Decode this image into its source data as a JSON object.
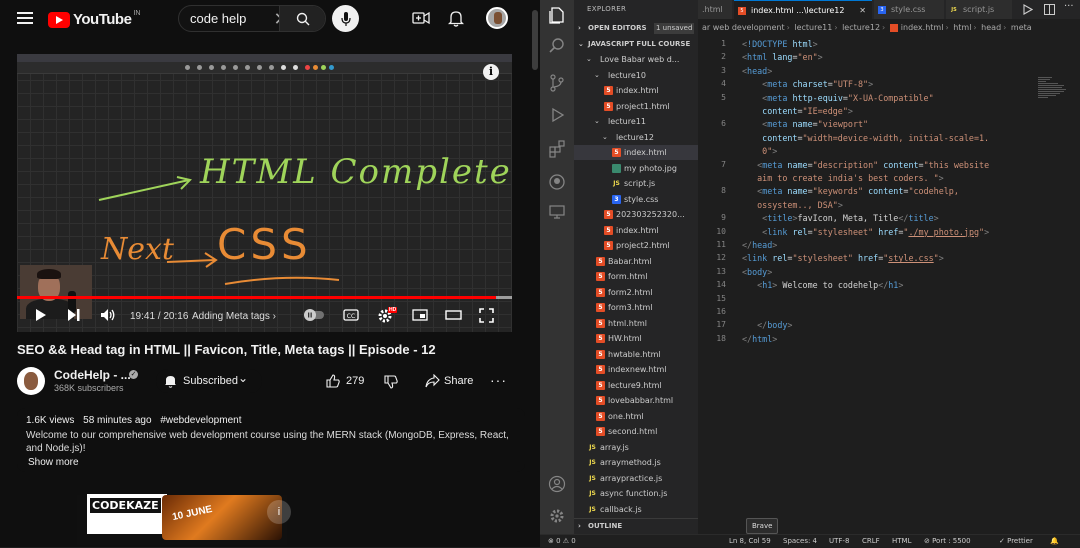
{
  "youtube": {
    "logo_text": "YouTube",
    "logo_region": "IN",
    "search_value": "code help",
    "video": {
      "handwriting_line1": "HTML Complete",
      "handwriting_next": "Next",
      "handwriting_css": "CSS",
      "time": "19:41 / 20:16",
      "chapter": "Adding Meta tags",
      "chapter_arrow": "›",
      "hd_badge": "HD",
      "progress_pct": 96.8,
      "loaded_pct": 100
    },
    "title": "SEO && Head tag in HTML || Favicon, Title, Meta tags || Episode - 12",
    "channel_name": "CodeHelp - ...",
    "verified_mark": "✓",
    "subscribers": "368K subscribers",
    "subscribed_label": "Subscribed",
    "subscribed_chevron": "⌄",
    "likes": "279",
    "share_label": "Share",
    "more_label": "···",
    "description": {
      "views": "1.6K views",
      "time_ago": "58 minutes ago",
      "hashtag": "#webdevelopment",
      "text": "Welcome to our comprehensive web development course using the MERN stack (MongoDB, Express, React, and Node.js)!",
      "show_more": "Show more"
    },
    "ad": {
      "brand": "CODEKAZE",
      "date": "10 JUNE",
      "info_glyph": "i"
    },
    "info_glyph": "i",
    "clear_glyph": "✕"
  },
  "vscode": {
    "explorer_title": "EXPLORER",
    "open_editors": "OPEN EDITORS",
    "unsaved": "1 unsaved",
    "workspace": "JAVASCRIPT FULL COURSE",
    "outline": "OUTLINE",
    "tree": [
      {
        "label": "Love Babar web d...",
        "kind": "folder",
        "indent": 1,
        "open": true
      },
      {
        "label": "lecture10",
        "kind": "folder",
        "indent": 2,
        "open": true
      },
      {
        "label": "index.html",
        "kind": "html",
        "indent": 3
      },
      {
        "label": "project1.html",
        "kind": "html",
        "indent": 3
      },
      {
        "label": "lecture11",
        "kind": "folder",
        "indent": 2,
        "open": true
      },
      {
        "label": "lecture12",
        "kind": "folder",
        "indent": 3,
        "open": true
      },
      {
        "label": "index.html",
        "kind": "html",
        "indent": 4,
        "selected": true
      },
      {
        "label": "my photo.jpg",
        "kind": "img",
        "indent": 4
      },
      {
        "label": "script.js",
        "kind": "js",
        "indent": 4
      },
      {
        "label": "style.css",
        "kind": "css",
        "indent": 4
      },
      {
        "label": "202303252320...",
        "kind": "html",
        "indent": 3
      },
      {
        "label": "index.html",
        "kind": "html",
        "indent": 3
      },
      {
        "label": "project2.html",
        "kind": "html",
        "indent": 3
      },
      {
        "label": "Babar.html",
        "kind": "html",
        "indent": 2
      },
      {
        "label": "form.html",
        "kind": "html",
        "indent": 2
      },
      {
        "label": "form2.html",
        "kind": "html",
        "indent": 2
      },
      {
        "label": "form3.html",
        "kind": "html",
        "indent": 2
      },
      {
        "label": "html.html",
        "kind": "html",
        "indent": 2
      },
      {
        "label": "HW.html",
        "kind": "html",
        "indent": 2
      },
      {
        "label": "hwtable.html",
        "kind": "html",
        "indent": 2
      },
      {
        "label": "indexnew.html",
        "kind": "html",
        "indent": 2
      },
      {
        "label": "lecture9.html",
        "kind": "html",
        "indent": 2
      },
      {
        "label": "lovebabbar.html",
        "kind": "html",
        "indent": 2
      },
      {
        "label": "one.html",
        "kind": "html",
        "indent": 2
      },
      {
        "label": "second.html",
        "kind": "html",
        "indent": 2
      },
      {
        "label": "array.js",
        "kind": "js",
        "indent": 1
      },
      {
        "label": "arraymethod.js",
        "kind": "js",
        "indent": 1
      },
      {
        "label": "arraypractice.js",
        "kind": "js",
        "indent": 1
      },
      {
        "label": "async function.js",
        "kind": "js",
        "indent": 1
      },
      {
        "label": "callback.js",
        "kind": "js",
        "indent": 1
      }
    ],
    "tabs": [
      {
        "label": ".html",
        "icon": ""
      },
      {
        "label": "index.html ...\\lecture12",
        "icon": "5",
        "active": true
      },
      {
        "label": "style.css",
        "icon": "3"
      },
      {
        "label": "script.js",
        "icon": "JS"
      }
    ],
    "breadcrumbs": [
      "ar web development",
      "lecture11",
      "lecture12",
      "index.html",
      "html",
      "head",
      "meta"
    ],
    "code_lines": [
      {
        "n": "1",
        "h": "<span class='p'>&lt;</span><span class='t'>!DOCTYPE</span> <span class='a'>html</span><span class='p'>&gt;</span>"
      },
      {
        "n": "2",
        "h": "<span class='p'>&lt;</span><span class='t'>html</span> <span class='a'>lang</span>=<span class='s'>\"en\"</span><span class='p'>&gt;</span>"
      },
      {
        "n": "3",
        "h": "<span class='p'>&lt;</span><span class='t'>head</span><span class='p'>&gt;</span>"
      },
      {
        "n": "4",
        "h": "    <span class='p'>&lt;</span><span class='t'>meta</span> <span class='a'>charset</span>=<span class='s'>\"UTF-8\"</span><span class='p'>&gt;</span>"
      },
      {
        "n": "5",
        "h": "    <span class='p'>&lt;</span><span class='t'>meta</span> <span class='a'>http-equiv</span>=<span class='s'>\"X-UA-Compatible\"</span>"
      },
      {
        "n": "",
        "h": "    <span class='a'>content</span>=<span class='s'>\"IE=edge\"</span><span class='p'>&gt;</span>"
      },
      {
        "n": "6",
        "h": "    <span class='p'>&lt;</span><span class='t'>meta</span> <span class='a'>name</span>=<span class='s'>\"viewport\"</span>"
      },
      {
        "n": "",
        "h": "    <span class='a'>content</span>=<span class='s'>\"width=device-width, initial-scale=1.</span>"
      },
      {
        "n": "",
        "h": "    <span class='s'>0\"</span><span class='p'>&gt;</span>"
      },
      {
        "n": "7",
        "h": "   <span class='p'>&lt;</span><span class='t'>meta</span> <span class='a'>name</span>=<span class='s'>\"description\"</span> <span class='a'>content</span>=<span class='s'>\"this website</span>"
      },
      {
        "n": "",
        "h": "   <span class='s'>aim to create india's best coders. \"</span><span class='p'>&gt;</span>"
      },
      {
        "n": "8",
        "h": "   <span class='p'>&lt;</span><span class='t'>meta</span> <span class='a'>name</span>=<span class='s'>\"keywords\"</span> <span class='a'>content</span>=<span class='s'>\"codehelp,</span>"
      },
      {
        "n": "",
        "h": "   <span class='s'>ossystem.., DSA\"</span><span class='p'>&gt;</span>"
      },
      {
        "n": "9",
        "h": "    <span class='p'>&lt;</span><span class='t'>title</span><span class='p'>&gt;</span><span class='w'>favIcon, Meta, Title</span><span class='p'>&lt;/</span><span class='t'>title</span><span class='p'>&gt;</span>"
      },
      {
        "n": "10",
        "h": "    <span class='p'>&lt;</span><span class='t'>link</span> <span class='a'>rel</span>=<span class='s'>\"stylesheet\"</span> <span class='a'>href</span>=<span class='s'>\"<u>./my photo.jpg</u>\"</span><span class='p'>&gt;</span>"
      },
      {
        "n": "11",
        "h": "<span class='p'>&lt;/</span><span class='t'>head</span><span class='p'>&gt;</span>"
      },
      {
        "n": "12",
        "h": "<span class='p'>&lt;</span><span class='t'>link</span> <span class='a'>rel</span>=<span class='s'>\"stylesheet\"</span> <span class='a'>href</span>=<span class='s'>\"<u>style.css</u>\"</span><span class='p'>&gt;</span>"
      },
      {
        "n": "13",
        "h": "<span class='p'>&lt;</span><span class='t'>body</span><span class='p'>&gt;</span>"
      },
      {
        "n": "14",
        "h": "   <span class='p'>&lt;</span><span class='t'>h1</span><span class='p'>&gt;</span><span class='w'> Welcome to codehelp</span><span class='p'>&lt;/</span><span class='t'>h1</span><span class='p'>&gt;</span>"
      },
      {
        "n": "15",
        "h": ""
      },
      {
        "n": "16",
        "h": ""
      },
      {
        "n": "17",
        "h": "   <span class='p'>&lt;/</span><span class='t'>body</span><span class='p'>&gt;</span>"
      },
      {
        "n": "18",
        "h": "<span class='p'>&lt;/</span><span class='t'>html</span><span class='p'>&gt;</span>"
      }
    ],
    "status": {
      "errors": "⊗ 0 ⚠ 0",
      "position": "Ln 8, Col 59",
      "spaces": "Spaces: 4",
      "encoding": "UTF-8",
      "eol": "CRLF",
      "language": "HTML",
      "port": "⊘ Port : 5500",
      "prettier": "✓ Prettier",
      "bell": "🔔"
    },
    "tooltip": "Brave"
  }
}
